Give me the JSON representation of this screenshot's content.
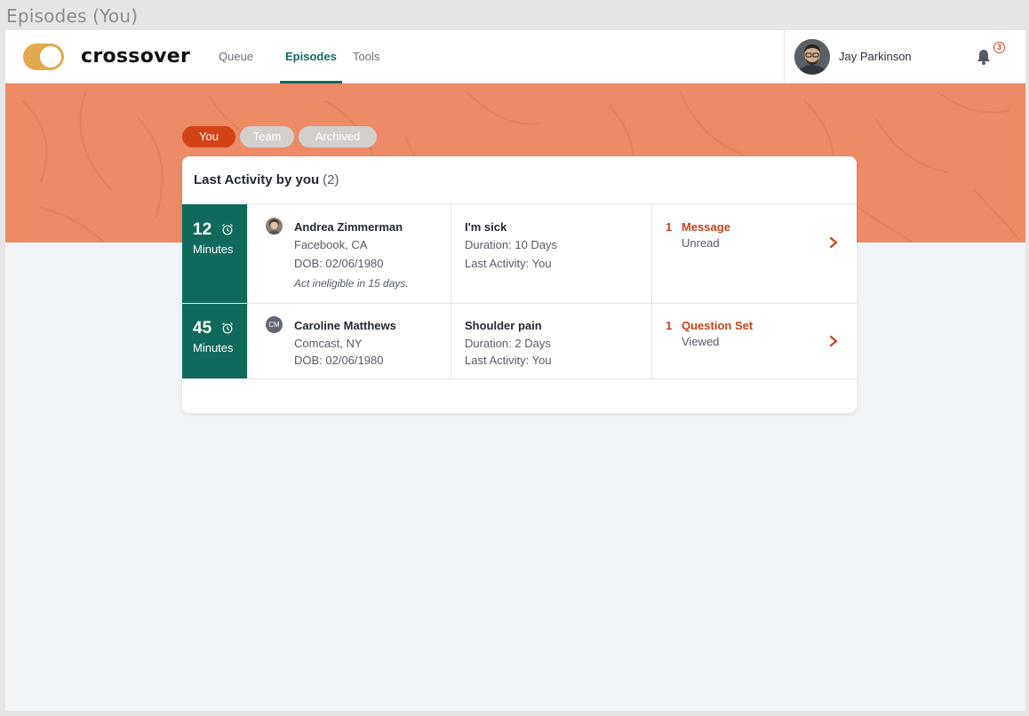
{
  "frame_title": "Episodes (You)",
  "header": {
    "brand": "crossover",
    "nav": [
      "Queue",
      "Episodes",
      "Tools"
    ],
    "active_nav": "Episodes",
    "user_name": "Jay Parkinson",
    "notification_count": "3"
  },
  "filters": [
    "You",
    "Team",
    "Archived"
  ],
  "active_filter": "You",
  "list": {
    "title": "Last Activity by you",
    "count": "(2)",
    "rows": [
      {
        "time_value": "12",
        "time_unit": "Minutes",
        "patient_name": "Andrea Zimmerman",
        "location": "Facebook, CA",
        "dob": "DOB: 02/06/1980",
        "note": "Act ineligible in 15 days.",
        "complaint": "I'm sick",
        "duration": "Duration: 10 Days",
        "last_activity": "Last Activity: You",
        "alert_count": "1",
        "alert_type": "Message",
        "alert_status": "Unread"
      },
      {
        "time_value": "45",
        "time_unit": "Minutes",
        "patient_initials": "CM",
        "patient_name": "Caroline Matthews",
        "location": "Comcast, NY",
        "dob": "DOB: 02/06/1980",
        "complaint": "Shoulder pain",
        "duration": "Duration: 2 Days",
        "last_activity": "Last Activity: You",
        "alert_count": "1",
        "alert_type": "Question Set",
        "alert_status": "Viewed"
      }
    ]
  },
  "colors": {
    "brand_teal": "#0f6a5c",
    "accent_orange": "#d24318",
    "banner": "#ec8b66",
    "toggle": "#e2a94f"
  }
}
